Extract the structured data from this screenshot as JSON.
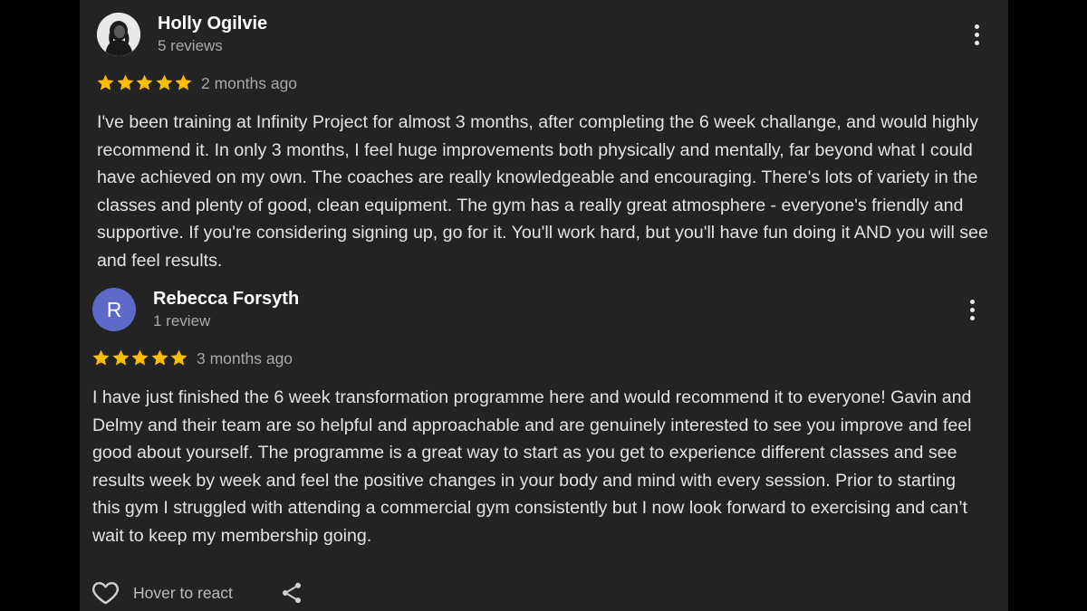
{
  "reviews": [
    {
      "name": "Holly Ogilvie",
      "review_count": "5 reviews",
      "rating": 5,
      "time": "2 months ago",
      "text": "I've been training at Infinity Project for almost 3 months, after completing the 6 week challange, and would highly recommend it. In only 3 months, I feel huge improvements both physically and mentally, far beyond what I could have achieved on my own. The coaches are really knowledgeable and encouraging. There's lots of variety in the classes and plenty of good, clean equipment. The gym has a really great atmosphere - everyone's friendly and supportive. If you're considering signing up, go for it. You'll work hard, but you'll have fun doing it AND you will see and feel results.",
      "avatar": "photo"
    },
    {
      "name": "Rebecca Forsyth",
      "review_count": "1 review",
      "rating": 5,
      "time": "3 months ago",
      "text": "I have just finished the 6 week transformation programme here and would recommend it to everyone! Gavin and Delmy and their team are so helpful and approachable and are genuinely interested to see you improve and feel good about yourself. The programme is a great way to start as you get to experience different classes and see results week by week and feel the positive changes in your body and mind with every session. Prior to starting this gym I struggled with attending a commercial gym consistently but I now look forward to exercising and can’t wait to keep my membership going.",
      "avatar_letter": "R",
      "avatar_color": "#5e6ac9"
    }
  ],
  "actions": {
    "react_label": "Hover to react",
    "react_icon": "heart-outline-icon",
    "share_icon": "share-icon"
  },
  "colors": {
    "background": "#000000",
    "panel": "#232323",
    "star": "#fbbc04",
    "text": "#e3e3e3",
    "muted": "#a8a8a8"
  }
}
